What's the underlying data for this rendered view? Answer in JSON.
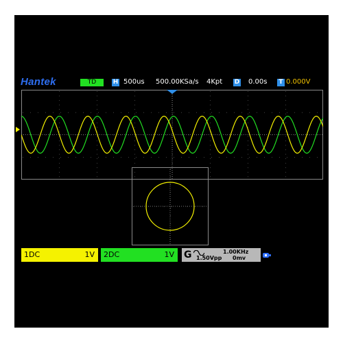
{
  "header": {
    "brand": "Hantek",
    "mode": "TD",
    "timebase_key": "H",
    "timebase": "500us",
    "sample_rate": "500.00KSa/s",
    "memory_depth": "4Kpt",
    "delay_key": "D",
    "delay": "0.00s",
    "trigger_key": "T",
    "trigger_level": "0.000V"
  },
  "channels": [
    {
      "label": "1DC",
      "scale": "1V",
      "color": "#f5f200"
    },
    {
      "label": "2DC",
      "scale": "1V",
      "color": "#22e022"
    }
  ],
  "generator": {
    "key": "G",
    "waveform_icon": "sine-wave-icon",
    "frequency": "1.00KHz",
    "amplitude": "1.50Vpp",
    "offset": "0mv"
  },
  "status_icons": [
    "usb-icon"
  ],
  "colors": {
    "screen_bg": "#000000",
    "brand": "#2e6ef0",
    "channel1": "#f5f200",
    "channel2": "#22e022",
    "key_badge": "#2f8fe8",
    "trigger_text": "#f2c200",
    "generator_bg": "#b8b8b8"
  }
}
